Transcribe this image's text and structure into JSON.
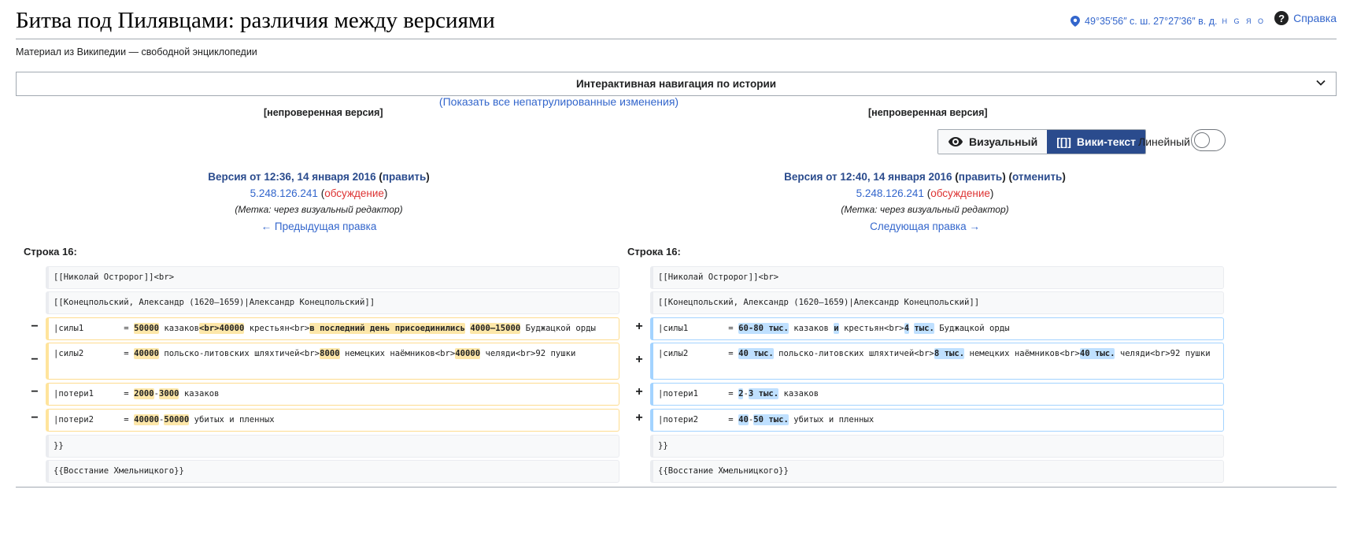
{
  "page": {
    "title": "Битва под Пилявцами: различия между версиями",
    "tagline": "Материал из Википедии — свободной энциклопедии",
    "coordinates": "49°35′56″ с. ш. 27°27′36″ в. д.",
    "coord_links": "H G Я O",
    "help_label": "Справка"
  },
  "nav": {
    "title": "Интерактивная навигация по истории",
    "patrol_open": "(",
    "patrol_link": "Показать все непатрулированные изменения",
    "patrol_close": ")"
  },
  "unverified_label": "[непроверенная версия]",
  "view": {
    "visual_label": "Визуальный",
    "wikitext_label": "Вики-текст",
    "wikitext_glyph": "[[]]",
    "linear_label": "Линейный",
    "linear_on": false
  },
  "left_rev": {
    "version": "Версия от 12:36, 14 января 2016",
    "edit": "править",
    "user": "5.248.126.241",
    "talk": "обсуждение",
    "tag": "(Метка: через визуальный редактор)",
    "nav": "← Предыдущая правка"
  },
  "right_rev": {
    "version": "Версия от 12:40, 14 января 2016",
    "edit": "править",
    "undo": "отменить",
    "user": "5.248.126.241",
    "talk": "обсуждение",
    "tag": "(Метка: через визуальный редактор)",
    "nav": "Следующая правка →"
  },
  "line_label": "Строка 16:",
  "context": {
    "c1": "[[Николай Остророг]]<br>",
    "c2": "[[Конецпольский, Александр (1620—1659)|Александр Конецпольский]]",
    "c3": "}}",
    "c4": "{{Восстание Хмельницкого}}"
  },
  "markers": {
    "minus": "−",
    "plus": "+"
  },
  "del": {
    "r1": [
      "|силы1        = ",
      "50000",
      " казаков",
      "<br>40000",
      " крестьян<br>",
      "в последний день присоединились",
      " ",
      "4000—15000",
      " Буджацкой орды"
    ],
    "r2": [
      "|силы2        = ",
      "40000",
      " польско-литовских шляхтичей<br>",
      "8000",
      " немецких наёмников<br>",
      "40000",
      " челяди<br>92 пушки"
    ],
    "r3": [
      "|потери1      = ",
      "2000",
      "-",
      "3000",
      " казаков"
    ],
    "r4": [
      "|потери2      = ",
      "40000",
      "-",
      "50000",
      " убитых и пленных"
    ]
  },
  "add": {
    "r1": [
      "|силы1        = ",
      "60-80 тыс.",
      " казаков ",
      "и",
      " крестьян<br>",
      "4",
      " ",
      "тыс.",
      " Буджацкой орды"
    ],
    "r2": [
      "|силы2        = ",
      "40 тыс.",
      " польско-литовских шляхтичей<br>",
      "8 тыс.",
      " немецких наёмников<br>",
      "40 тыс.",
      " челяди<br>92 пушки"
    ],
    "r3": [
      "|потери1      = ",
      "2",
      "-",
      "3 тыс.",
      " казаков"
    ],
    "r4": [
      "|потери2      = ",
      "40",
      "-",
      "50 тыс.",
      " убитых и пленных"
    ]
  }
}
